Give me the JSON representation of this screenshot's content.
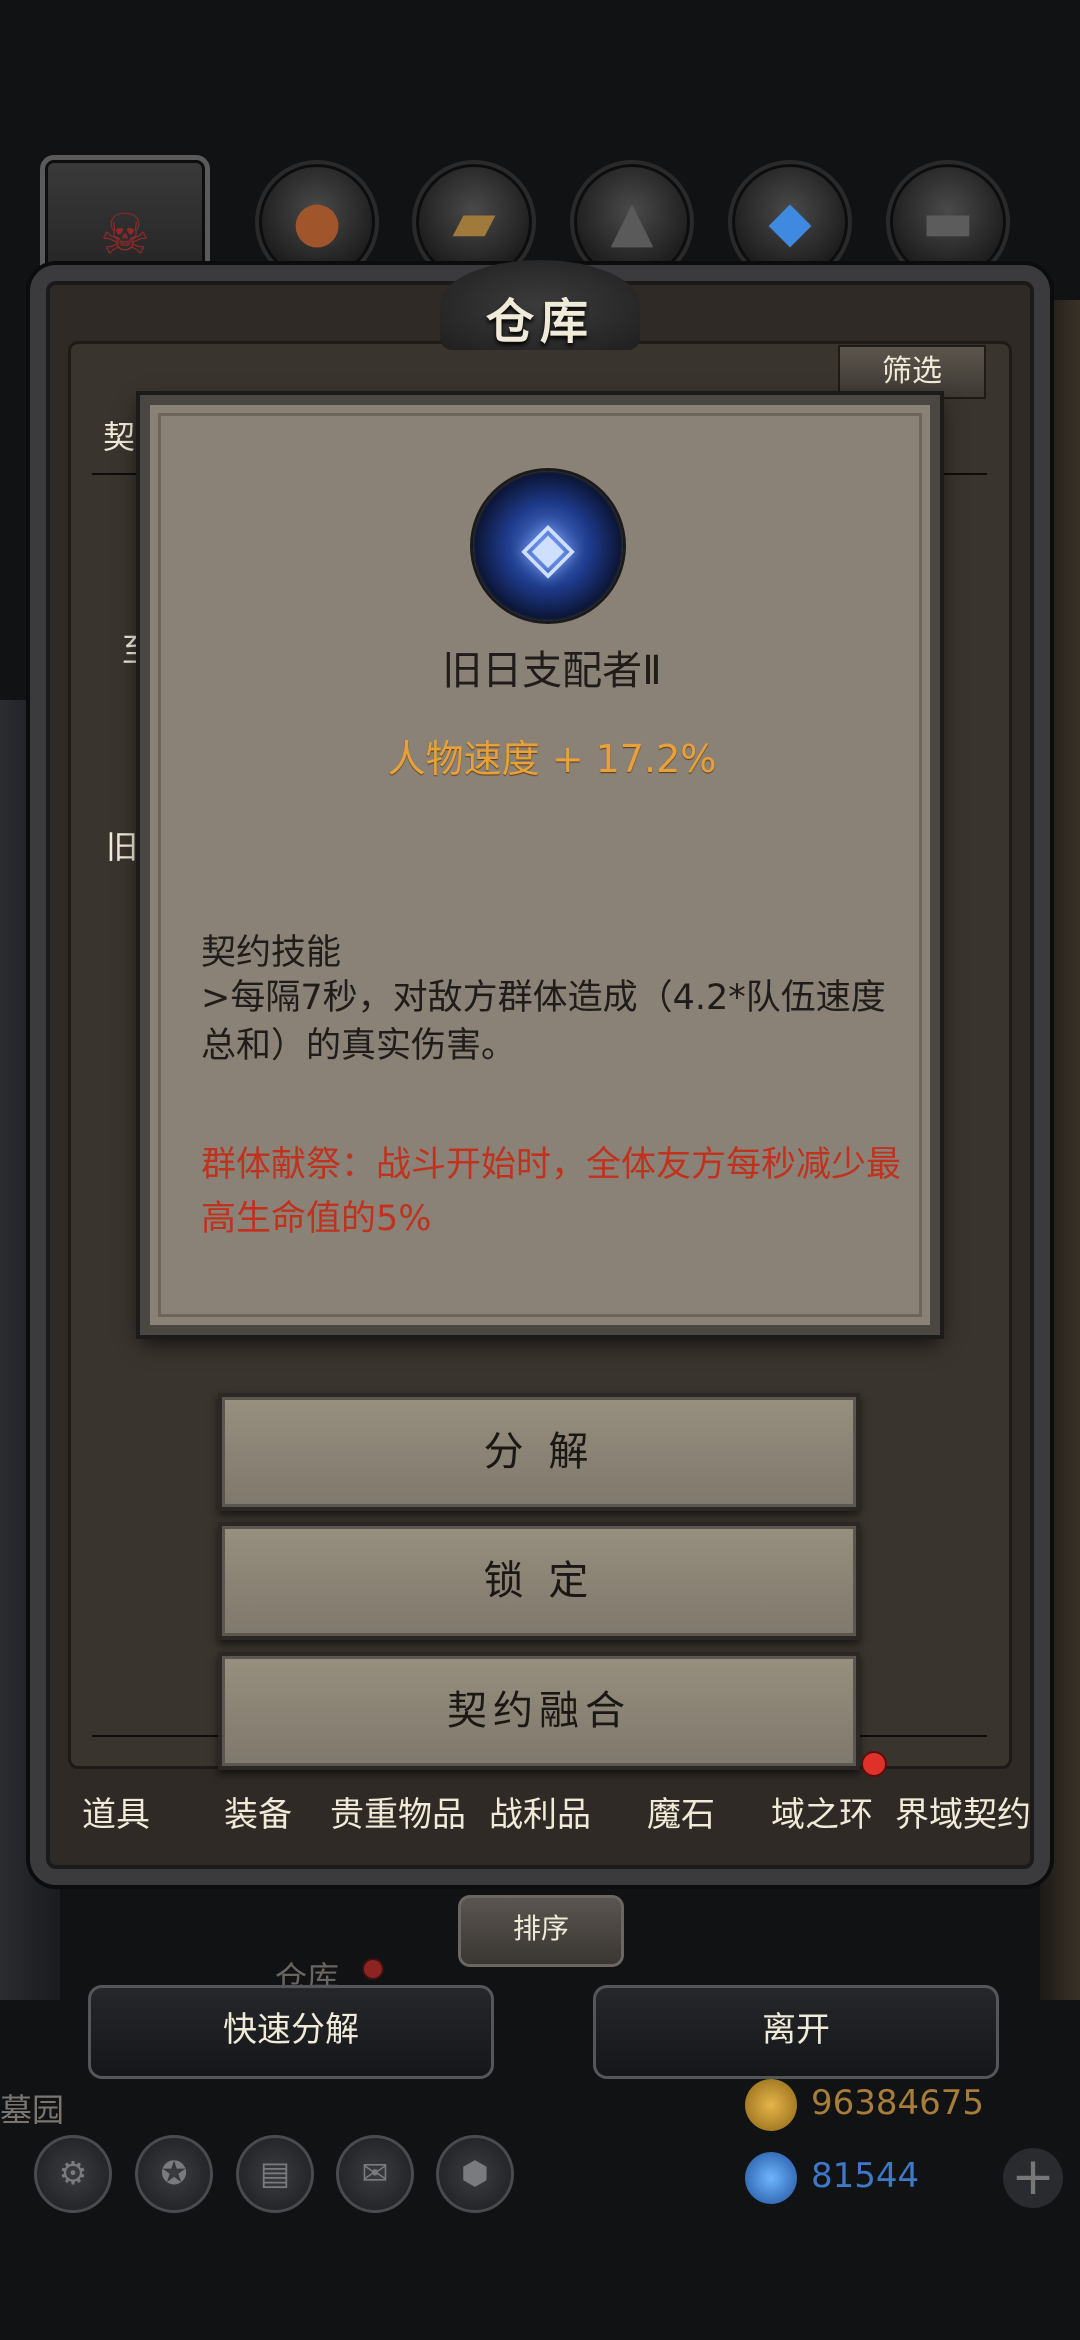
{
  "frame": {
    "title": "仓库",
    "filter_label": "筛选"
  },
  "side_labels": {
    "contract": "契",
    "row1": "至",
    "row2": "旧"
  },
  "tooltip": {
    "item_name": "旧日支配者Ⅱ",
    "stat": "人物速度 + 17.2%",
    "skill_title": "契约技能",
    "skill_desc": ">每隔7秒，对敌方群体造成（4.2*队伍速度总和）的真实伤害。",
    "curse": "群体献祭：战斗开始时，全体友方每秒减少最高生命值的5%",
    "stat_color": "#e8a13a",
    "curse_color": "#c0321e"
  },
  "actions": {
    "decompose": "分 解",
    "lock": "锁 定",
    "fuse": "契约融合"
  },
  "tabs": [
    "道具",
    "装备",
    "贵重物品",
    "战利品",
    "魔石",
    "域之环",
    "界域契约"
  ],
  "sort_label": "排序",
  "ghost": {
    "warehouse": "仓库",
    "graveyard": "墓园"
  },
  "bottom_buttons": {
    "quick_decompose": "快速分解",
    "leave": "离开"
  },
  "currency": {
    "gold": "96384675",
    "gems": "81544"
  }
}
